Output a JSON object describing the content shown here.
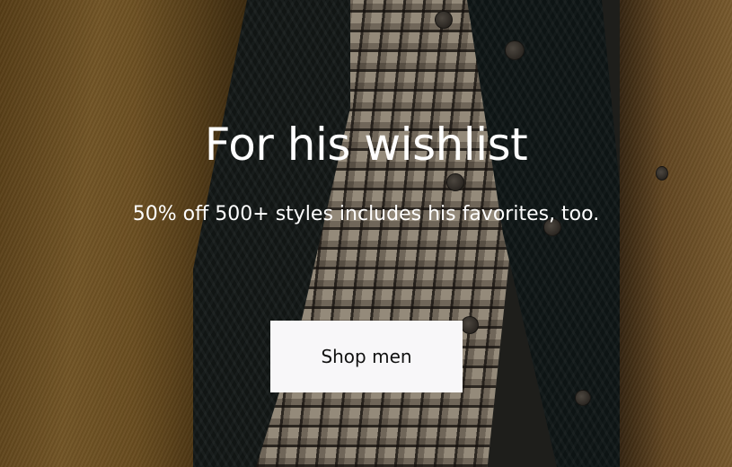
{
  "hero": {
    "headline": "For his wishlist",
    "subline": "50% off 500+ styles includes his favorites, too.",
    "cta_label": "Shop men"
  },
  "colors": {
    "text": "#ffffff",
    "button_bg": "#f8f7f9",
    "button_text": "#111111",
    "coat": "#a07736",
    "vest": "#1c2322",
    "shirt": "#cdbfa9"
  },
  "background_image": "menswear-flatlay"
}
